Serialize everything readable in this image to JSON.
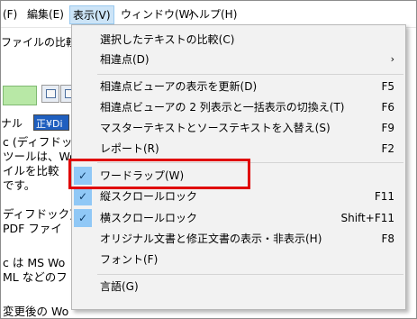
{
  "menubar": {
    "items": [
      "(F)",
      "編集(E)",
      "表示(V)",
      "ウィンドウ(W)",
      "ヘルプ(H)"
    ]
  },
  "background": {
    "file_tab": "ファイルの比較",
    "row_label": "ナル",
    "path_value": "正¥Di",
    "lines": [
      "c (ディフドック",
      "ツールは、Wo",
      "イルを比較",
      "です。",
      "ディフドック)",
      "PDF ファイ",
      "c は MS Wo",
      "ML などのフ",
      "変更後の Wo"
    ]
  },
  "menu": {
    "items": [
      {
        "label": "選択したテキストの比較(C)",
        "shortcut": "",
        "checked": false,
        "submenu": false
      },
      {
        "label": "相違点(D)",
        "shortcut": "",
        "checked": false,
        "submenu": true
      },
      {
        "label": "相違点ビューアの表示を更新(D)",
        "shortcut": "F5",
        "checked": false,
        "submenu": false
      },
      {
        "label": "相違点ビューアの 2 列表示と一括表示の切換え(T)",
        "shortcut": "F6",
        "checked": false,
        "submenu": false
      },
      {
        "label": "マスターテキストとソーステキストを入替え(S)",
        "shortcut": "F9",
        "checked": false,
        "submenu": false
      },
      {
        "label": "レポート(R)",
        "shortcut": "F2",
        "checked": false,
        "submenu": false
      },
      {
        "label": "ワードラップ(W)",
        "shortcut": "",
        "checked": true,
        "submenu": false
      },
      {
        "label": "縦スクロールロック",
        "shortcut": "F11",
        "checked": true,
        "submenu": false
      },
      {
        "label": "横スクロールロック",
        "shortcut": "Shift+F11",
        "checked": true,
        "submenu": false
      },
      {
        "label": "オリジナル文書と修正文書の表示・非表示(H)",
        "shortcut": "F8",
        "checked": false,
        "submenu": false
      },
      {
        "label": "フォント(F)",
        "shortcut": "",
        "checked": false,
        "submenu": false
      },
      {
        "label": "言語(G)",
        "shortcut": "",
        "checked": false,
        "submenu": false
      }
    ],
    "check_glyph": "✓",
    "submenu_arrow": "›"
  },
  "colors": {
    "highlight_border": "#e00000",
    "check_background": "#90c8f6",
    "menu_background": "#f2f2f2",
    "active_menu": "#cce4f7"
  }
}
